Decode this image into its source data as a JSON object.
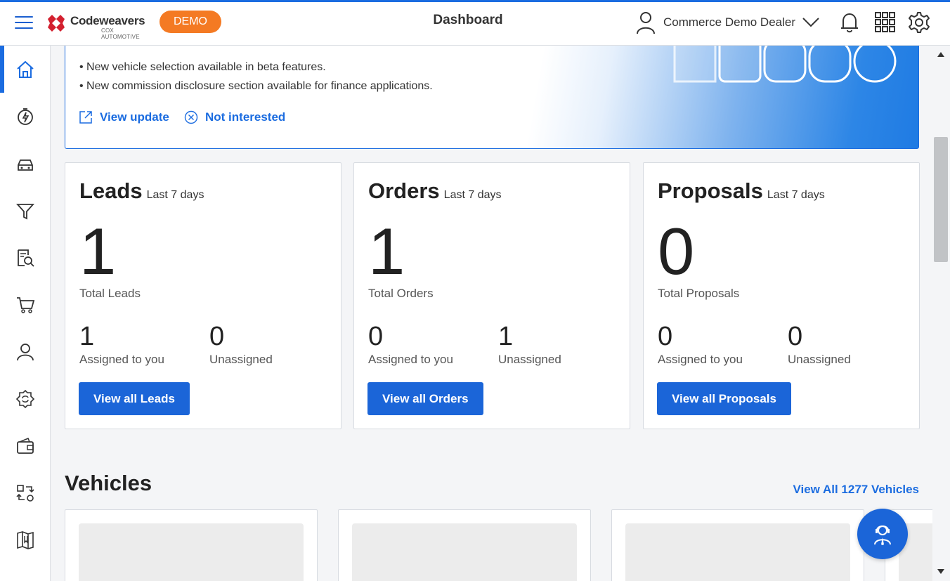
{
  "header": {
    "brand_name": "Codeweavers",
    "brand_sub": "COX AUTOMOTIVE",
    "demo_badge": "DEMO",
    "title": "Dashboard",
    "user_name": "Commerce Demo Dealer"
  },
  "banner": {
    "lines": [
      "• New vehicle selection available in beta features.",
      "• New commission disclosure section available for finance applications."
    ],
    "view_update": "View update",
    "not_interested": "Not interested"
  },
  "cards": [
    {
      "title": "Leads",
      "period": "Last 7 days",
      "total": "1",
      "total_label": "Total Leads",
      "assigned": "1",
      "assigned_label": "Assigned to you",
      "unassigned": "0",
      "unassigned_label": "Unassigned",
      "button": "View all Leads"
    },
    {
      "title": "Orders",
      "period": "Last 7 days",
      "total": "1",
      "total_label": "Total Orders",
      "assigned": "0",
      "assigned_label": "Assigned to you",
      "unassigned": "1",
      "unassigned_label": "Unassigned",
      "button": "View all Orders"
    },
    {
      "title": "Proposals",
      "period": "Last 7 days",
      "total": "0",
      "total_label": "Total Proposals",
      "assigned": "0",
      "assigned_label": "Assigned to you",
      "unassigned": "0",
      "unassigned_label": "Unassigned",
      "button": "View all Proposals"
    }
  ],
  "vehicles": {
    "title": "Vehicles",
    "view_all": "View All 1277 Vehicles"
  },
  "sidebar_icons": [
    "home-icon",
    "lightning-gauge-icon",
    "car-icon",
    "funnel-icon",
    "document-search-icon",
    "cart-icon",
    "users-icon",
    "refresh-badge-icon",
    "wallet-icon",
    "swap-icon",
    "map-icon"
  ],
  "colors": {
    "accent": "#1b6ce0",
    "button": "#1b65d8",
    "demo_badge": "#f47a23",
    "logo_red": "#d3202f"
  }
}
